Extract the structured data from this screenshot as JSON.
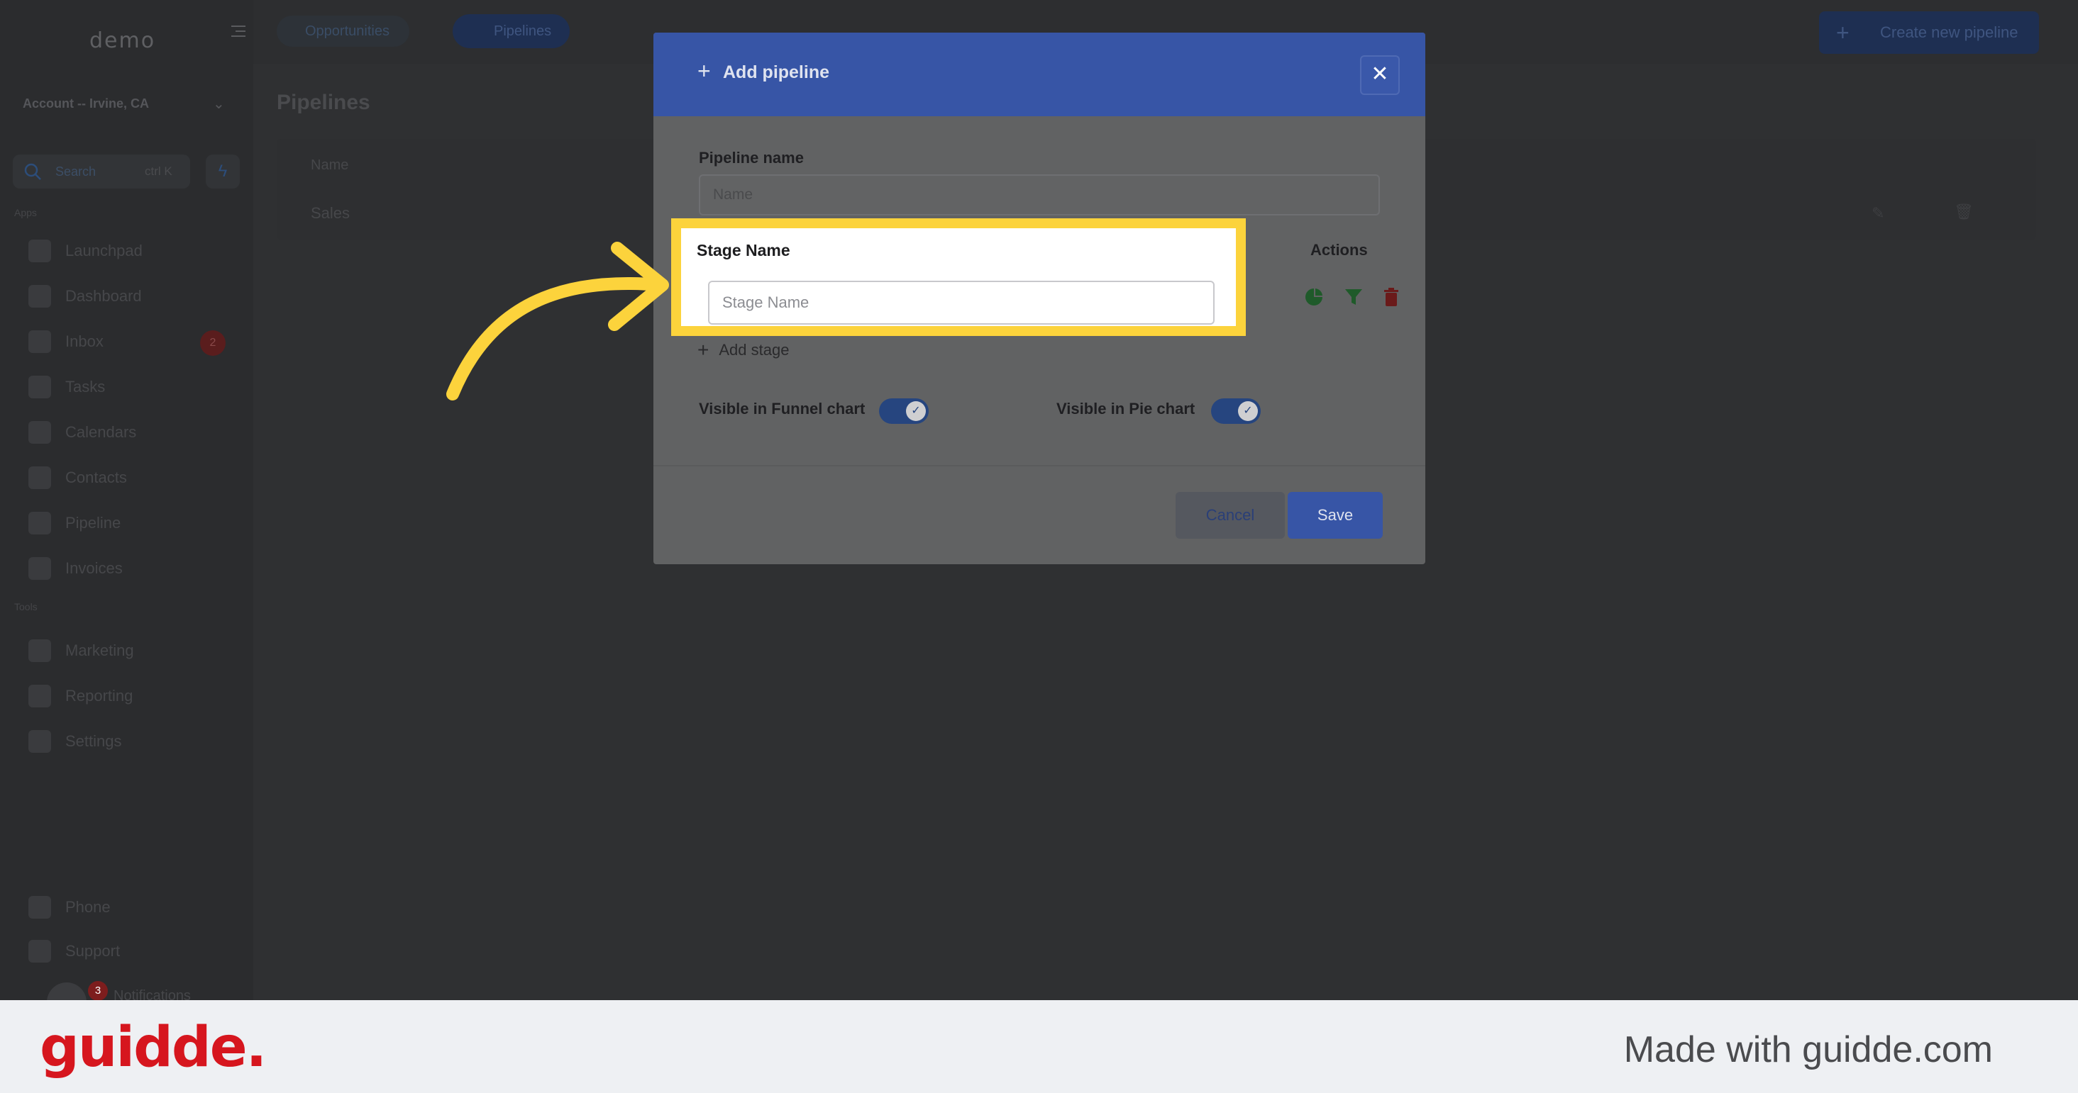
{
  "app": {
    "logo": "demo",
    "account": "Account -- Irvine, CA",
    "search": {
      "label": "Search",
      "shortcut": "ctrl K"
    },
    "sections": {
      "apps": "Apps",
      "tools": "Tools"
    },
    "nav": [
      "Launchpad",
      "Dashboard",
      "Inbox",
      "Tasks",
      "Calendars",
      "Contacts",
      "Pipeline",
      "Invoices"
    ],
    "inbox_badge": "2",
    "tools_nav": [
      "Marketing",
      "Reporting",
      "Settings"
    ],
    "bottom_nav": {
      "phone": "Phone",
      "support": "Support",
      "notifications_label": "Notifications",
      "notifications_badge": "3"
    },
    "topbar": {
      "tab_opportunities": "Opportunities",
      "tab_pipelines": "Pipelines",
      "create_button": "Create new pipeline"
    },
    "page_title": "Pipelines",
    "table": {
      "col_name": "Name",
      "rows": [
        "Sales"
      ]
    }
  },
  "modal": {
    "title": "Add pipeline",
    "close_glyph": "✕",
    "pipeline_name_label": "Pipeline name",
    "pipeline_name_placeholder": "Name",
    "stage_name_label": "Stage Name",
    "stage_name_placeholder": "Stage Name",
    "actions_label": "Actions",
    "add_stage": "Add stage",
    "funnel_toggle_label": "Visible in Funnel chart",
    "pie_toggle_label": "Visible in Pie chart",
    "cancel": "Cancel",
    "save": "Save"
  },
  "footer": {
    "brand": "guidde.",
    "made_with": "Made with guidde.com"
  },
  "colors": {
    "highlight": "#fcd33c",
    "brand": "#d6161e",
    "modal_header": "#3755a6"
  }
}
